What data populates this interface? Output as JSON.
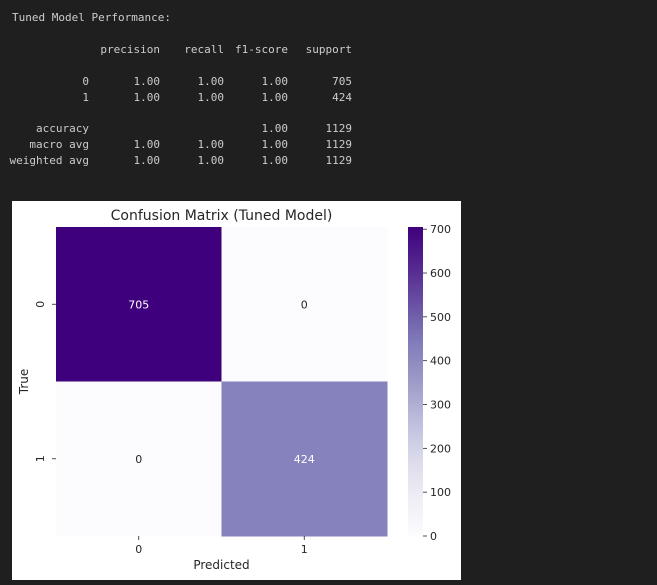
{
  "output": {
    "title": "Tuned Model Performance:",
    "headers": [
      "precision",
      "recall",
      "f1-score",
      "support"
    ],
    "class_rows": [
      {
        "label": "0",
        "precision": "1.00",
        "recall": "1.00",
        "f1": "1.00",
        "support": "705"
      },
      {
        "label": "1",
        "precision": "1.00",
        "recall": "1.00",
        "f1": "1.00",
        "support": "424"
      }
    ],
    "summary_rows": [
      {
        "label": "accuracy",
        "precision": "",
        "recall": "",
        "f1": "1.00",
        "support": "1129"
      },
      {
        "label": "macro avg",
        "precision": "1.00",
        "recall": "1.00",
        "f1": "1.00",
        "support": "1129"
      },
      {
        "label": "weighted avg",
        "precision": "1.00",
        "recall": "1.00",
        "f1": "1.00",
        "support": "1129"
      }
    ]
  },
  "chart_data": {
    "type": "heatmap",
    "title": "Confusion Matrix (Tuned Model)",
    "xlabel": "Predicted",
    "ylabel": "True",
    "x_categories": [
      "0",
      "1"
    ],
    "y_categories": [
      "0",
      "1"
    ],
    "values": [
      [
        705,
        0
      ],
      [
        0,
        424
      ]
    ],
    "colormap": "Purples",
    "colorbar": {
      "min": 0,
      "max": 705,
      "ticks": [
        0,
        100,
        200,
        300,
        400,
        500,
        600,
        700
      ]
    },
    "colors": {
      "high": "#3f007d",
      "mid": "#8785bf",
      "low": "#fcfbfd"
    }
  }
}
